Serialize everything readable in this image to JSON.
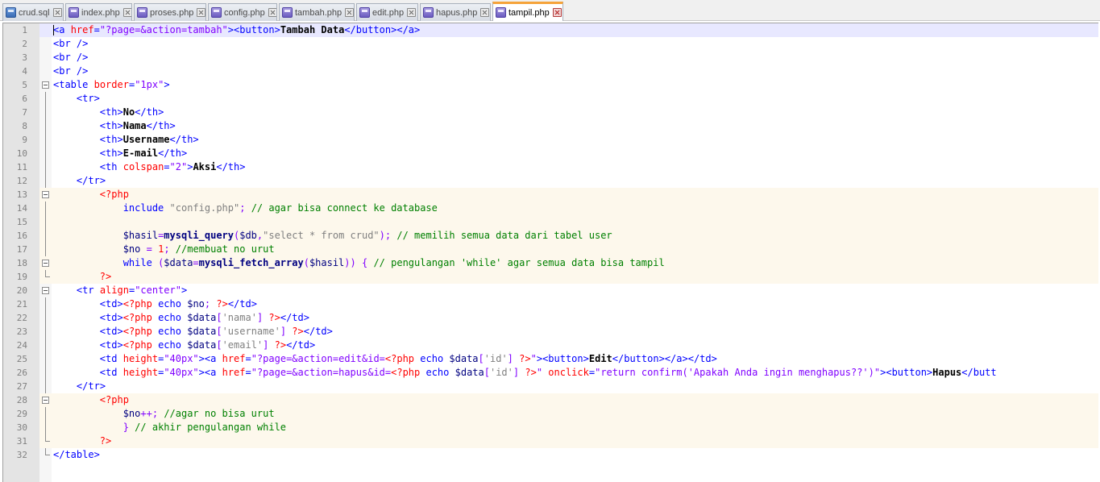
{
  "tabs": [
    {
      "label": "crud.sql",
      "kind": "sql",
      "active": false
    },
    {
      "label": "index.php",
      "kind": "php",
      "active": false
    },
    {
      "label": "proses.php",
      "kind": "php",
      "active": false
    },
    {
      "label": "config.php",
      "kind": "php",
      "active": false
    },
    {
      "label": "tambah.php",
      "kind": "php",
      "active": false
    },
    {
      "label": "edit.php",
      "kind": "php",
      "active": false
    },
    {
      "label": "hapus.php",
      "kind": "php",
      "active": false
    },
    {
      "label": "tampil.php",
      "kind": "php",
      "active": true
    }
  ],
  "colors": {
    "tag": "#0000ff",
    "attr": "#ff0000",
    "string": "#8000ff",
    "comment": "#008000",
    "php_block_bg": "#fdf8ec",
    "active_tab_accent": "#f5a33a"
  },
  "editor": {
    "lines": [
      {
        "n": "1",
        "code": "<a href=\"?page=&action=tambah\"><button>Tambah Data</button></a>"
      },
      {
        "n": "2",
        "code": "<br />"
      },
      {
        "n": "3",
        "code": "<br />"
      },
      {
        "n": "4",
        "code": "<br />"
      },
      {
        "n": "5",
        "code": "<table border=\"1px\">"
      },
      {
        "n": "6",
        "code": "    <tr>"
      },
      {
        "n": "7",
        "code": "        <th>No</th>"
      },
      {
        "n": "8",
        "code": "        <th>Nama</th>"
      },
      {
        "n": "9",
        "code": "        <th>Username</th>"
      },
      {
        "n": "10",
        "code": "        <th>E-mail</th>"
      },
      {
        "n": "11",
        "code": "        <th colspan=\"2\">Aksi</th>"
      },
      {
        "n": "12",
        "code": "    </tr>"
      },
      {
        "n": "13",
        "code": "        <?php"
      },
      {
        "n": "14",
        "code": "            include \"config.php\"; // agar bisa connect ke database"
      },
      {
        "n": "15",
        "code": ""
      },
      {
        "n": "16",
        "code": "            $hasil=mysqli_query($db,\"select * from crud\"); // memilih semua data dari tabel user"
      },
      {
        "n": "17",
        "code": "            $no = 1; //membuat no urut"
      },
      {
        "n": "18",
        "code": "            while ($data=mysqli_fetch_array($hasil)) { // pengulangan 'while' agar semua data bisa tampil"
      },
      {
        "n": "19",
        "code": "        ?>"
      },
      {
        "n": "20",
        "code": "    <tr align=\"center\">"
      },
      {
        "n": "21",
        "code": "        <td><?php echo $no; ?></td>"
      },
      {
        "n": "22",
        "code": "        <td><?php echo $data['nama'] ?></td>"
      },
      {
        "n": "23",
        "code": "        <td><?php echo $data['username'] ?></td>"
      },
      {
        "n": "24",
        "code": "        <td><?php echo $data['email'] ?></td>"
      },
      {
        "n": "25",
        "code": "        <td height=\"40px\"><a href=\"?page=&action=edit&id=<?php echo $data['id'] ?>\"><button>Edit</button></a></td>"
      },
      {
        "n": "26",
        "code": "        <td height=\"40px\"><a href=\"?page=&action=hapus&id=<?php echo $data['id'] ?>\" onclick=\"return confirm('Apakah Anda ingin menghapus??')\"><button>Hapus</butt"
      },
      {
        "n": "27",
        "code": "    </tr>"
      },
      {
        "n": "28",
        "code": "        <?php"
      },
      {
        "n": "29",
        "code": "            $no++; //agar no bisa urut"
      },
      {
        "n": "30",
        "code": "            } // akhir pengulangan while"
      },
      {
        "n": "31",
        "code": "        ?>"
      },
      {
        "n": "32",
        "code": "</table>"
      }
    ]
  }
}
